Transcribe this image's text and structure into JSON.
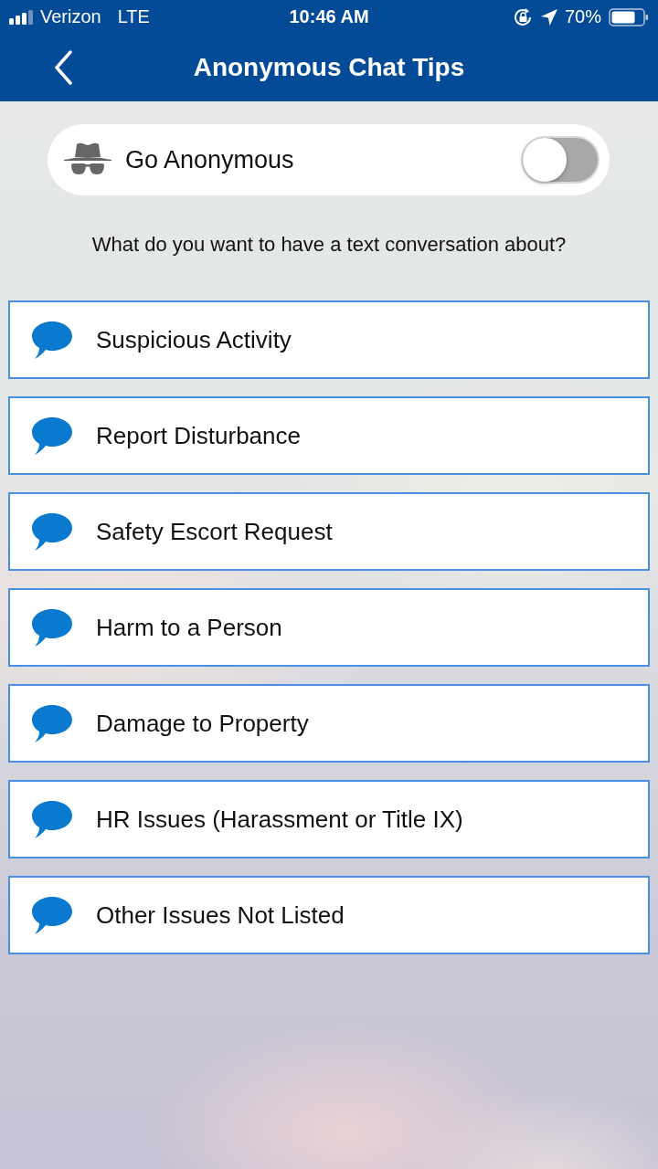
{
  "status_bar": {
    "carrier": "Verizon",
    "network": "LTE",
    "time": "10:46 AM",
    "battery": "70%"
  },
  "nav_bar": {
    "title": "Anonymous Chat Tips"
  },
  "anonymous_toggle": {
    "label": "Go Anonymous",
    "on": false
  },
  "prompt": "What do you want to have a text conversation about?",
  "topics": [
    {
      "label": "Suspicious Activity"
    },
    {
      "label": "Report Disturbance"
    },
    {
      "label": "Safety Escort Request"
    },
    {
      "label": "Harm to a Person"
    },
    {
      "label": "Damage to Property"
    },
    {
      "label": "HR Issues (Harassment or Title IX)"
    },
    {
      "label": "Other Issues Not Listed"
    }
  ]
}
